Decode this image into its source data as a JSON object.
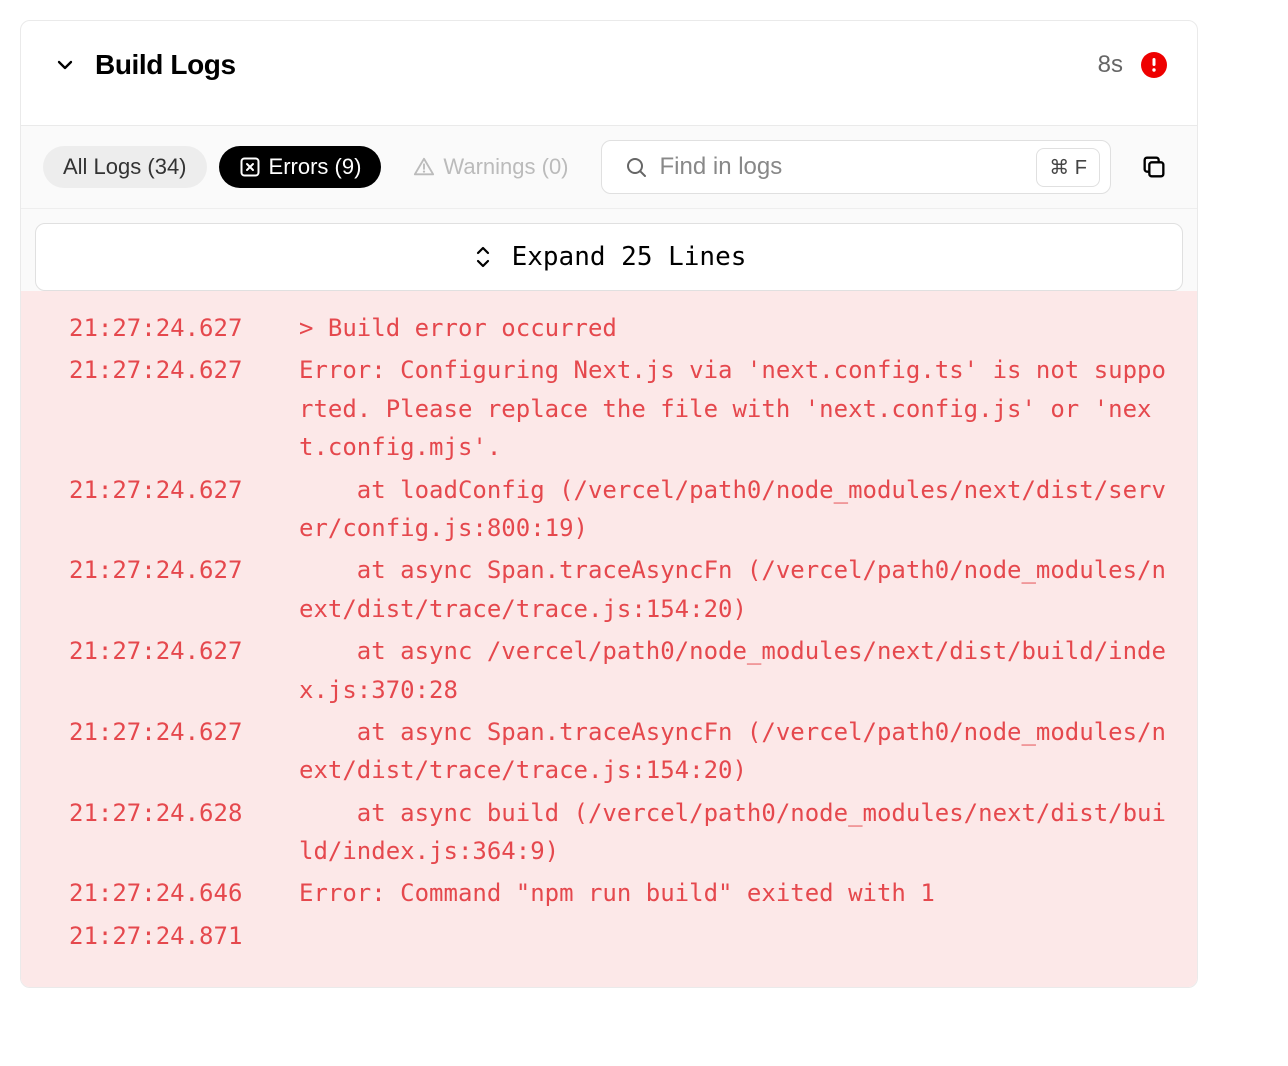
{
  "header": {
    "title": "Build Logs",
    "duration": "8s",
    "status": "error"
  },
  "filters": {
    "all": {
      "label": "All Logs",
      "count": 34
    },
    "errors": {
      "label": "Errors",
      "count": 9
    },
    "warnings": {
      "label": "Warnings",
      "count": 0
    }
  },
  "search": {
    "placeholder": "Find in logs",
    "shortcut": "⌘ F"
  },
  "expand": {
    "label": "Expand 25 Lines"
  },
  "logs": [
    {
      "ts": "21:27:24.627",
      "msg": "> Build error occurred"
    },
    {
      "ts": "21:27:24.627",
      "msg": "Error: Configuring Next.js via 'next.config.ts' is not supported. Please replace the file with 'next.config.js' or 'next.config.mjs'."
    },
    {
      "ts": "21:27:24.627",
      "msg": "    at loadConfig (/vercel/path0/node_modules/next/dist/server/config.js:800:19)"
    },
    {
      "ts": "21:27:24.627",
      "msg": "    at async Span.traceAsyncFn (/vercel/path0/node_modules/next/dist/trace/trace.js:154:20)"
    },
    {
      "ts": "21:27:24.627",
      "msg": "    at async /vercel/path0/node_modules/next/dist/build/index.js:370:28"
    },
    {
      "ts": "21:27:24.627",
      "msg": "    at async Span.traceAsyncFn (/vercel/path0/node_modules/next/dist/trace/trace.js:154:20)"
    },
    {
      "ts": "21:27:24.628",
      "msg": "    at async build (/vercel/path0/node_modules/next/dist/build/index.js:364:9)"
    },
    {
      "ts": "21:27:24.646",
      "msg": "Error: Command \"npm run build\" exited with 1"
    },
    {
      "ts": "21:27:24.871",
      "msg": ""
    }
  ]
}
